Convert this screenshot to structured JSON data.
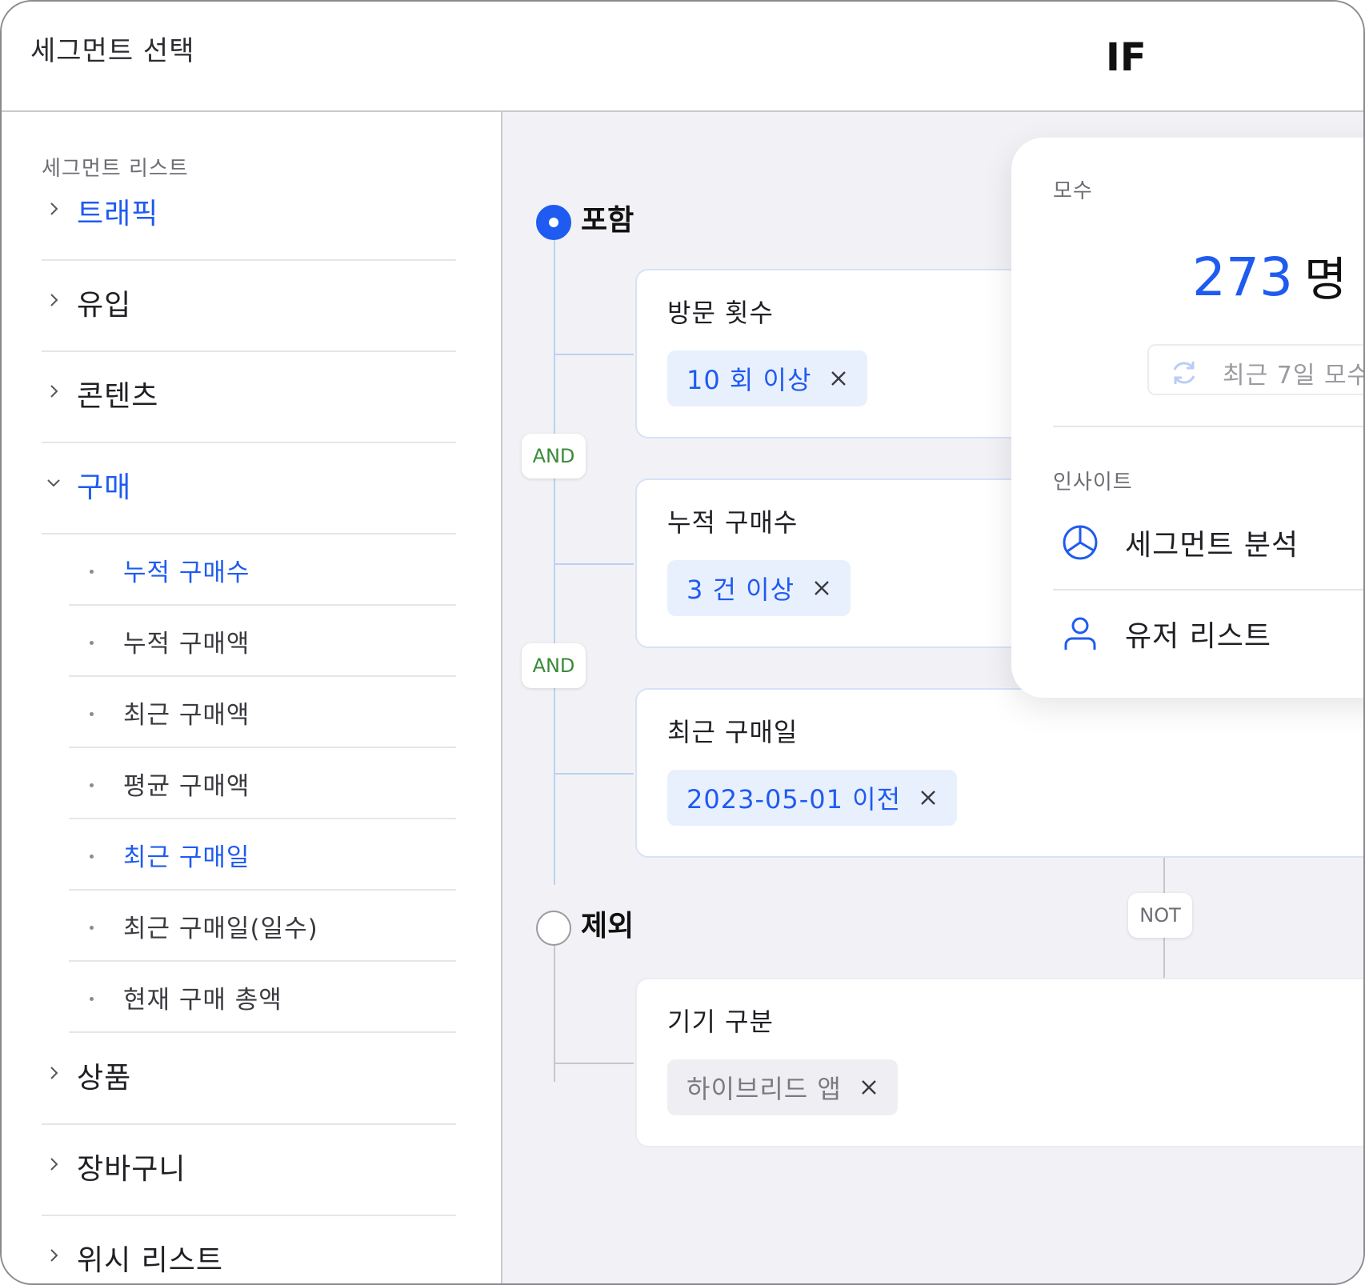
{
  "header": {
    "title": "세그먼트 선택",
    "mode": "IF"
  },
  "sidebar": {
    "caption": "세그먼트 리스트",
    "categories": [
      {
        "label": "트래픽",
        "expanded": false,
        "active": true
      },
      {
        "label": "유입",
        "expanded": false,
        "active": false
      },
      {
        "label": "콘텐츠",
        "expanded": false,
        "active": false
      },
      {
        "label": "구매",
        "expanded": true,
        "active": true
      },
      {
        "label": "상품",
        "expanded": false,
        "active": false
      },
      {
        "label": "장바구니",
        "expanded": false,
        "active": false
      },
      {
        "label": "위시 리스트",
        "expanded": false,
        "active": false
      }
    ],
    "purchase_items": [
      {
        "label": "누적 구매수",
        "selected": true
      },
      {
        "label": "누적 구매액",
        "selected": false
      },
      {
        "label": "최근 구매액",
        "selected": false
      },
      {
        "label": "평균 구매액",
        "selected": false
      },
      {
        "label": "최근 구매일",
        "selected": true
      },
      {
        "label": "최근 구매일(일수)",
        "selected": false
      },
      {
        "label": "현재 구매 총액",
        "selected": false
      }
    ]
  },
  "include": {
    "label": "포함",
    "selected": true,
    "operator": "AND",
    "conditions": [
      {
        "title": "방문 횟수",
        "chip": "10 회 이상"
      },
      {
        "title": "누적 구매수",
        "chip": "3 건 이상"
      },
      {
        "title": "최근 구매일",
        "chip": "2023-05-01 이전"
      }
    ]
  },
  "exclude": {
    "label": "제외",
    "selected": false,
    "operator": "NOT",
    "conditions": [
      {
        "title": "기기 구분",
        "chip": "하이브리드 앱"
      }
    ]
  },
  "panel": {
    "population_caption": "모수",
    "count": "273",
    "count_unit": "명",
    "refresh_label": "최근 7일 모수",
    "insight_caption": "인사이트",
    "insights": [
      {
        "label": "세그먼트 분석",
        "icon": "pie-chart-icon"
      },
      {
        "label": "유저 리스트",
        "icon": "user-icon"
      }
    ]
  },
  "colors": {
    "accent": "#1f5bf0",
    "and": "#3a8a3a",
    "chip_bg": "#e9f0fd",
    "canvas_bg": "#f2f2f6"
  }
}
